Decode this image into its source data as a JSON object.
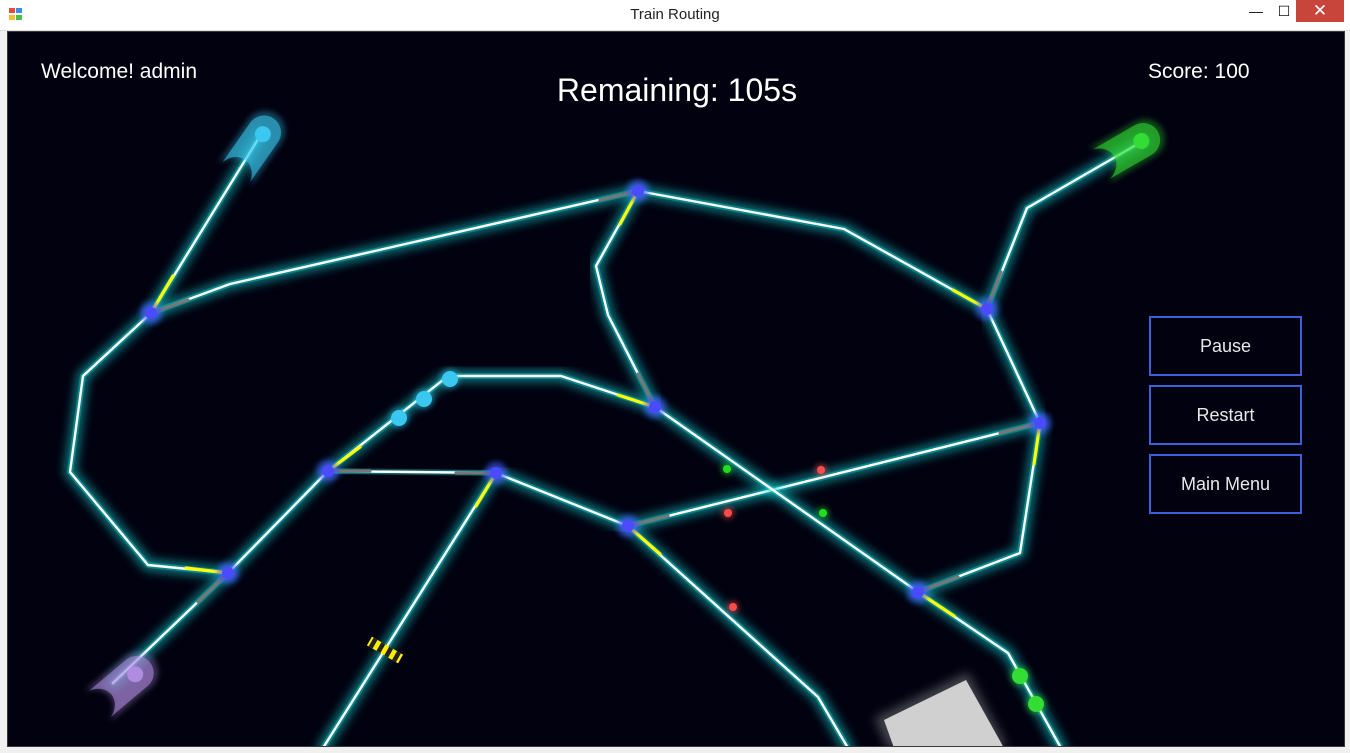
{
  "window": {
    "title": "Train Routing",
    "minimize_glyph": "—",
    "maximize_glyph": "☐",
    "close_glyph": "✕",
    "close_color": "#c7453a"
  },
  "hud": {
    "welcome": "Welcome! admin",
    "remaining": "Remaining: 105s",
    "score": "Score: 100"
  },
  "buttons": {
    "pause": "Pause",
    "restart": "Restart",
    "main_menu": "Main Menu"
  },
  "colors": {
    "background": "#01010f",
    "track": "#ffffff",
    "track_glow": "#19d6d6",
    "junction": "#4a4aff",
    "switch_active": "#ffff00",
    "switch_inactive": "#777777",
    "button_border": "#3f5fd8",
    "station_blue": "#3ac8f0",
    "station_green": "#33dd33",
    "station_purple": "#b08ce0",
    "signal_red": "#ff4a4a",
    "signal_green": "#22dd22"
  },
  "stations": [
    {
      "name": "blue-station",
      "color": "#3ac8f0"
    },
    {
      "name": "green-station",
      "color": "#33dd33"
    },
    {
      "name": "purple-station",
      "color": "#b08ce0"
    }
  ],
  "trains": [
    {
      "name": "blue-train",
      "color": "#3ac8f0",
      "cars": 3
    },
    {
      "name": "green-train",
      "color": "#33dd33",
      "cars": 2
    }
  ]
}
